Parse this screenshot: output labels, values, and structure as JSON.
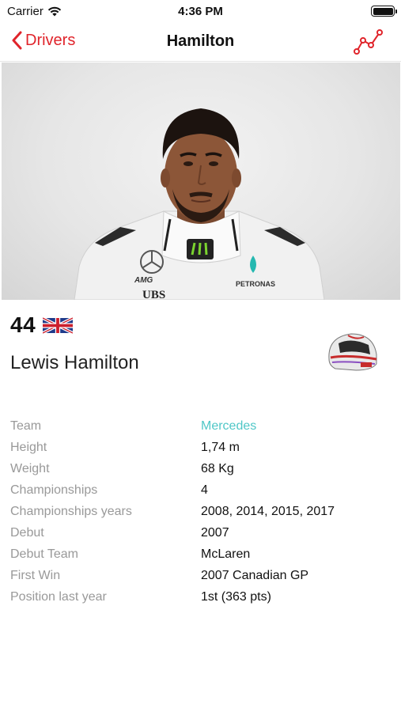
{
  "status_bar": {
    "carrier": "Carrier",
    "time": "4:36 PM"
  },
  "nav": {
    "back_label": "Drivers",
    "title": "Hamilton",
    "accent_color": "#e0242b"
  },
  "driver": {
    "number": "44",
    "name": "Lewis Hamilton",
    "flag_icon": "uk-flag-icon",
    "helmet_icon": "helmet-icon"
  },
  "info": {
    "link_color": "#4fc7c7",
    "rows": [
      {
        "label": "Team",
        "value": "Mercedes"
      },
      {
        "label": "Height",
        "value": "1,74 m"
      },
      {
        "label": "Weight",
        "value": "68 Kg"
      },
      {
        "label": "Championships",
        "value": "4"
      },
      {
        "label": "Championships years",
        "value": "2008, 2014, 2015, 2017"
      },
      {
        "label": "Debut",
        "value": "2007"
      },
      {
        "label": "Debut Team",
        "value": "McLaren"
      },
      {
        "label": "First Win",
        "value": "2007 Canadian GP"
      },
      {
        "label": "Position last year",
        "value": "1st (363 pts)"
      }
    ]
  },
  "hero_logos": {
    "sponsor_1": "AMG",
    "sponsor_2": "PETRONAS",
    "sponsor_3": "UBS"
  }
}
